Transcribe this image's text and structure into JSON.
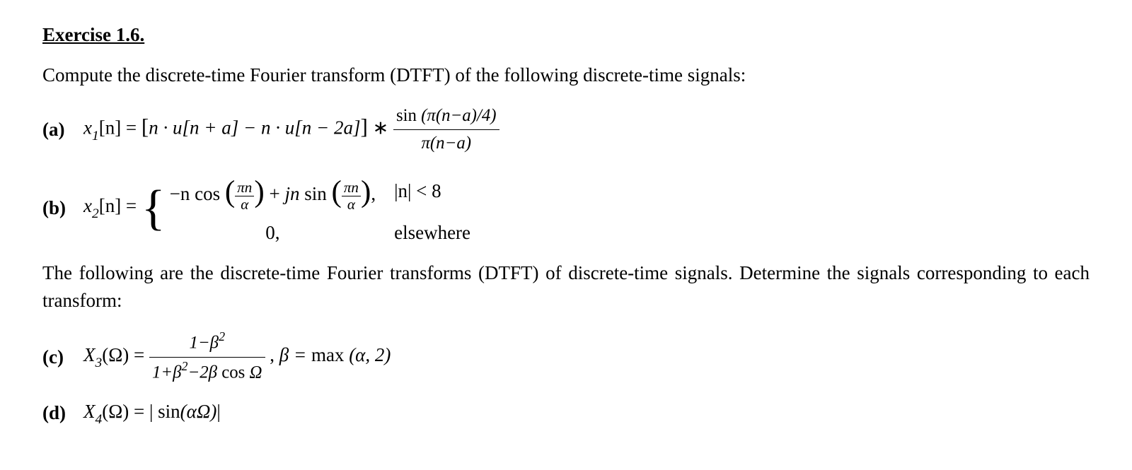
{
  "title": "Exercise 1.6.",
  "intro": "Compute the discrete-time Fourier transform (DTFT) of the following discrete-time signals:",
  "bodyText": "The following are the discrete-time Fourier transforms (DTFT) of discrete-time signals. Determine the signals corresponding to each transform:",
  "labels": {
    "a": "(a)",
    "b": "(b)",
    "c": "(c)",
    "d": "(d)"
  },
  "a": {
    "lhs_pre": "x",
    "lhs_sub": "1",
    "lhs_post": "[n] = ",
    "term1": "n · u[n + a] − n · u[n − 2a]",
    "conv": " ∗ ",
    "frac_num_fn": "sin ",
    "frac_num_arg": "(π(n−a)/4)",
    "frac_den": "π(n−a)"
  },
  "b": {
    "lhs_pre": "x",
    "lhs_sub": "2",
    "lhs_post": "[n] = ",
    "row1_expr_neg": "−n ",
    "row1_cos": "cos ",
    "row1_plus": " + ",
    "row1_jn": "jn ",
    "row1_sin": "sin ",
    "frac_num": "πn",
    "frac_den": "α",
    "row1_comma": ",",
    "row1_cond": "|n| < 8",
    "row2_expr": "0,",
    "row2_cond": "elsewhere"
  },
  "c": {
    "lhs_pre": "X",
    "lhs_sub": "3",
    "lhs_post": "(Ω) = ",
    "frac_num_pre": "1−β",
    "frac_num_sup": "2",
    "frac_den_pre": "1+β",
    "frac_den_sup": "2",
    "frac_den_post": "−2β ",
    "frac_den_cos": "cos ",
    "frac_den_omega": "Ω",
    "comma": " , ",
    "beta_def": "β = ",
    "max_fn": "max ",
    "max_arg": "(α, 2)"
  },
  "d": {
    "lhs_pre": "X",
    "lhs_sub": "4",
    "lhs_post": "(Ω) = | ",
    "sin_fn": "sin",
    "sin_arg": "(αΩ)",
    "bar_close": "|"
  }
}
